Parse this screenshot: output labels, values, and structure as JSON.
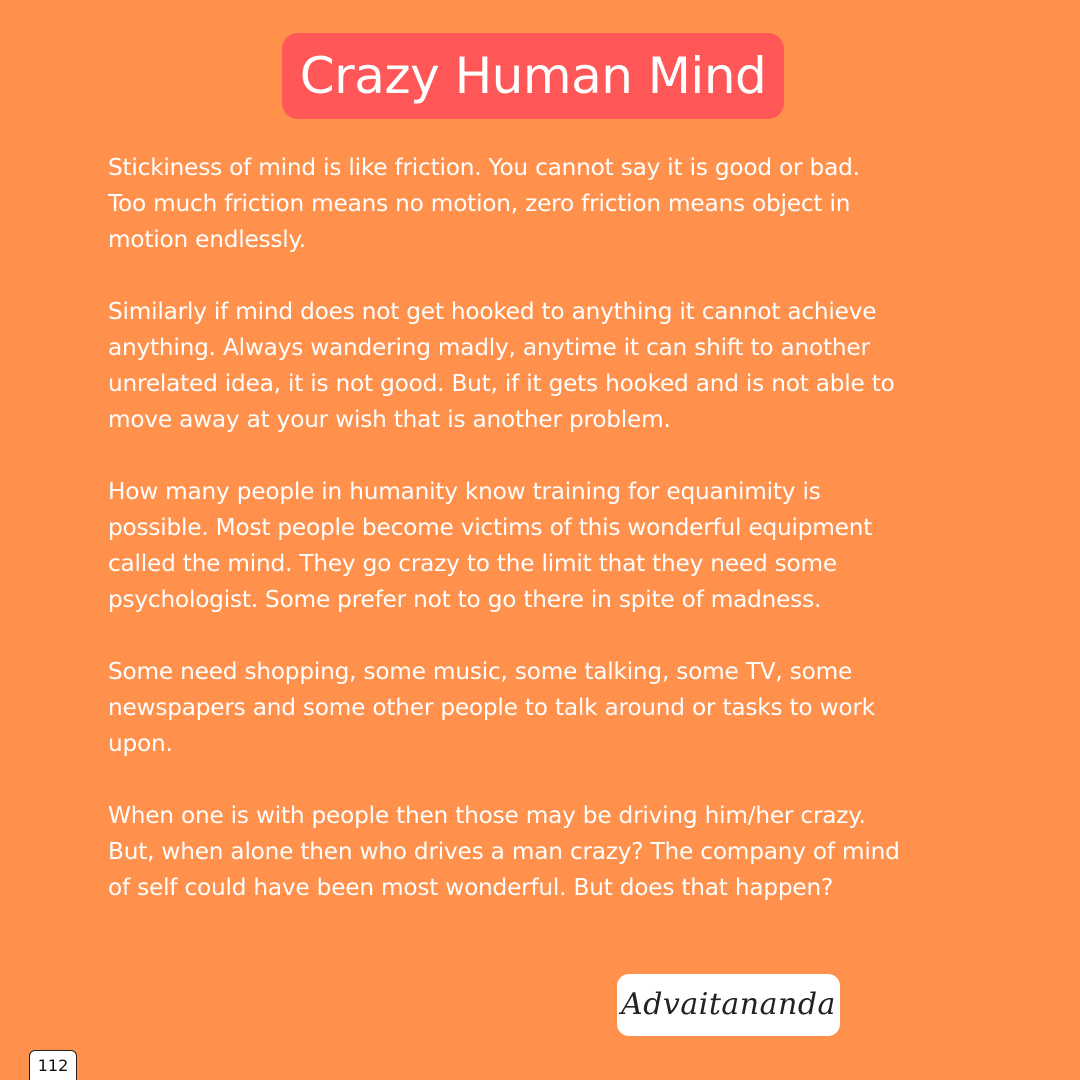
{
  "title": "Crazy Human Mind",
  "paragraphs": [
    {
      "lines": [
        "Stickiness of mind is like friction. You cannot say it is good or bad.",
        "Too much friction means no motion, zero friction means object in",
        "motion endlessly."
      ]
    },
    {
      "lines": [
        "Similarly if mind does not get hooked to anything it cannot achieve",
        "anything. Always wandering madly, anytime it can shift to another",
        "unrelated idea, it is not good. But, if it gets hooked and is not able to",
        "move away at your wish that is another problem."
      ]
    },
    {
      "lines": [
        "How many people in humanity know training for equanimity is",
        "possible. Most people become victims of this wonderful equipment",
        "called the mind. They go crazy to the limit that they need some",
        "psychologist. Some prefer not to go there in spite of madness."
      ]
    },
    {
      "lines": [
        "Some need shopping, some music, some talking, some TV, some",
        "newspapers and some other people to talk around or tasks to work",
        "upon."
      ]
    },
    {
      "lines": [
        "When one is with people then those may be driving him/her crazy.",
        "But, when alone then who drives a man crazy? The company of mind",
        "of self could have been most wonderful. But does that happen?"
      ]
    }
  ],
  "signature": "Advaitananda",
  "page_number": "112",
  "colors": {
    "background": "#ff914d",
    "title_pill": "#ff5757",
    "text": "#ffffff"
  }
}
